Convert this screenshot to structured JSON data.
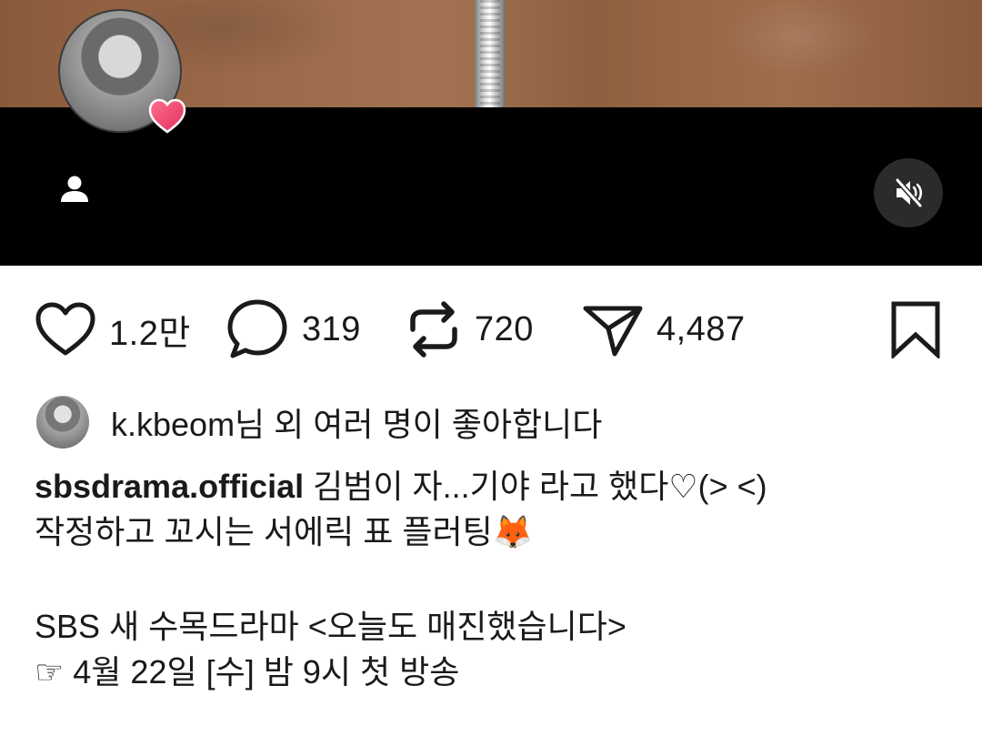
{
  "post": {
    "actions": {
      "likes": "1.2만",
      "comments": "319",
      "reposts": "720",
      "shares": "4,487"
    },
    "liked_by": "k.kbeom님 외 여러 명이 좋아합니다",
    "caption": {
      "username": "sbsdrama.official",
      "line1": "김범이 자...기야 라고 했다♡(> <)",
      "line2": "작정하고 꼬시는 서에릭 표 플러팅🦊",
      "line3": "SBS 새 수목드라마 <오늘도 매진했습니다>",
      "line4": "☞ 4월 22일 [수] 밤 9시 첫 방송"
    }
  },
  "icons": {
    "like": "heart-icon",
    "comment": "comment-bubble-icon",
    "repost": "repost-icon",
    "share": "send-icon",
    "save": "bookmark-icon",
    "user": "person-icon",
    "mute": "speaker-muted-icon",
    "badge": "heart-badge-icon"
  },
  "colors": {
    "badge": "#f0506e",
    "mute_bg": "#2b2b2b",
    "text": "#1a1a1a"
  }
}
